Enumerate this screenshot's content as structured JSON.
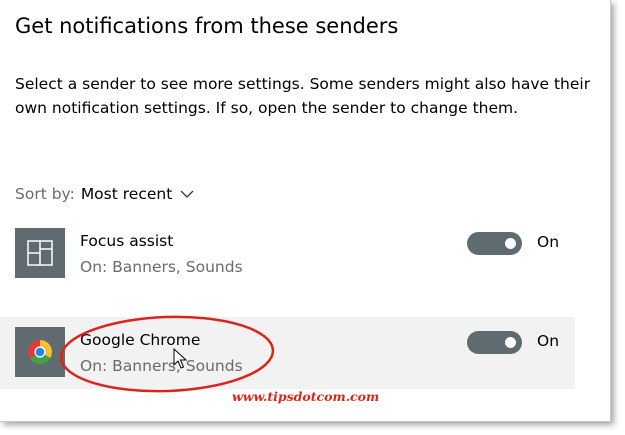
{
  "header": {
    "title": "Get notifications from these senders"
  },
  "description": "Select a sender to see more settings. Some senders might also have their own notification settings. If so, open the sender to change them.",
  "sort": {
    "label": "Sort by:",
    "value": "Most recent",
    "icon": "chevron-down-icon"
  },
  "senders": [
    {
      "name": "Focus assist",
      "status": "On: Banners, Sounds",
      "toggle_state": "On",
      "toggle_on": true,
      "icon": "focus-assist-icon",
      "icon_bg": "#5f6b6f"
    },
    {
      "name": "Google Chrome",
      "status": "On: Banners, Sounds",
      "toggle_state": "On",
      "toggle_on": true,
      "icon": "chrome-icon",
      "icon_bg": "#5f6b6f",
      "hovered": true
    }
  ],
  "annotation": {
    "color": "#d9261c"
  },
  "watermark": "www.tipsdotcom.com",
  "colors": {
    "toggle_on": "#5f6b6f",
    "secondary_text": "#6b6b6b",
    "hover_row": "#f2f2f2"
  }
}
